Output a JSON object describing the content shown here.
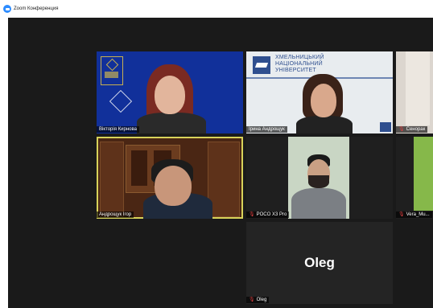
{
  "window": {
    "title": "Zoom Конференция"
  },
  "participants": [
    {
      "name": "Вікторія Кирнова",
      "muted": false
    },
    {
      "name": "Ірина Андрощук",
      "muted": false
    },
    {
      "name": "Сенорак",
      "muted": true
    },
    {
      "name": "Андрощук Ігор",
      "muted": false
    },
    {
      "name": "POCO X3 Pro",
      "muted": true
    },
    {
      "name": "Vera_Mu...",
      "muted": true
    },
    {
      "name": "Oleg",
      "muted": true,
      "avatar_text": "Oleg"
    }
  ],
  "university_banner": [
    "ХМЕЛЬНИЦЬКИЙ",
    "НАЦІОНАЛЬНИЙ",
    "УНІВЕРСИТЕТ"
  ],
  "colors": {
    "active_speaker": "#d8d35a",
    "muted_icon": "#e04040",
    "app_blue": "#2d8cff"
  }
}
